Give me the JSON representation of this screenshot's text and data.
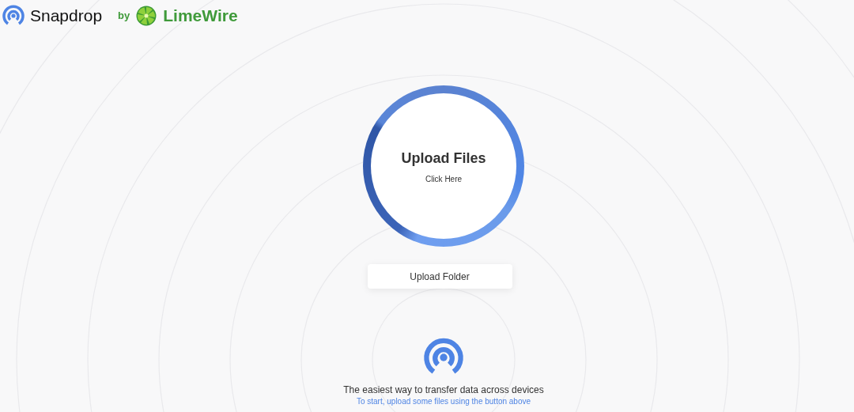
{
  "header": {
    "app_name": "Snapdrop",
    "by": "by",
    "partner": "LimeWire"
  },
  "upload": {
    "title": "Upload Files",
    "subtitle": "Click Here",
    "folder_button": "Upload Folder"
  },
  "footer": {
    "tagline": "The easiest way to transfer data across devices",
    "hint": "To start, upload some files using the button above"
  }
}
